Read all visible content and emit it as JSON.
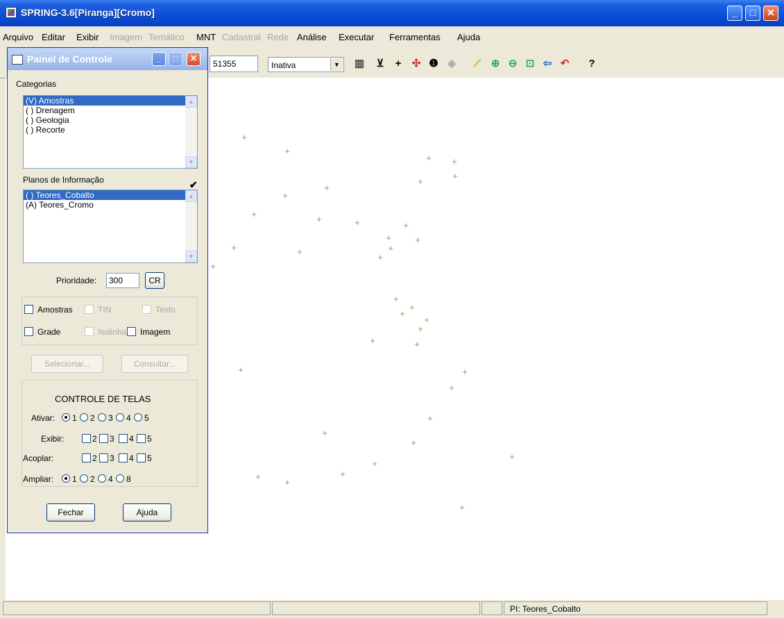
{
  "window": {
    "title": "SPRING-3.6[Piranga][Cromo]"
  },
  "menu": [
    {
      "label": "Arquivo",
      "enabled": true
    },
    {
      "label": "Editar",
      "enabled": true
    },
    {
      "label": "Exibir",
      "enabled": true
    },
    {
      "label": "Imagem",
      "enabled": false
    },
    {
      "label": "Temático",
      "enabled": false
    },
    {
      "label": "MNT",
      "enabled": true
    },
    {
      "label": "Cadastral",
      "enabled": false
    },
    {
      "label": "Rede",
      "enabled": false
    },
    {
      "label": "Análise",
      "enabled": true
    },
    {
      "label": "Executar",
      "enabled": true
    },
    {
      "label": "Ferramentas",
      "enabled": true
    },
    {
      "label": "Ajuda",
      "enabled": true
    }
  ],
  "toolbar": {
    "coord_value": "51355",
    "mode_selected": "Inativa",
    "icons": [
      "histogram-icon",
      "cursor-area-icon",
      "plus-icon",
      "pan-icon",
      "info-icon",
      "disabled-tool-icon",
      "pencil-icon",
      "zoom-in-icon",
      "zoom-out-icon",
      "zoom-area-icon",
      "back-arrow-icon",
      "undo-icon",
      "help-icon"
    ]
  },
  "panel": {
    "title": "Painel de Controle",
    "categorias_label": "Categorias",
    "categorias": [
      "(V) Amostras",
      "( ) Drenagem",
      "( ) Geologia",
      "( ) Recorte"
    ],
    "planos_label": "Planos de Informação",
    "planos": [
      "( ) Teores_Cobalto",
      "(A) Teores_Cromo"
    ],
    "prioridade_label": "Prioridade:",
    "prioridade_value": "300",
    "cr_label": "CR",
    "checks": {
      "amostras": "Amostras",
      "tin": "TIN",
      "texto": "Texto",
      "grade": "Grade",
      "isolinhas": "Isolinhas",
      "imagem": "Imagem"
    },
    "selecionar_label": "Selecionar...",
    "consultar_label": "Consultar...",
    "controle_title": "CONTROLE DE TELAS",
    "ativar_label": "Ativar:",
    "exibir_label": "Exibir:",
    "acoplar_label": "Acoplar:",
    "ampliar_label": "Ampliar:",
    "telas": [
      "1",
      "2",
      "3",
      "4",
      "5"
    ],
    "telas_opt": [
      "2",
      "3",
      "4",
      "5"
    ],
    "ampliar_opts": [
      "1",
      "2",
      "4",
      "8"
    ],
    "fechar_label": "Fechar",
    "ajuda_label": "Ajuda"
  },
  "status": {
    "pi": "PI: Teores_Cobalto"
  },
  "sample_marker": "+",
  "samples": [
    [
      352,
      197
    ],
    [
      414,
      217
    ],
    [
      618,
      227
    ],
    [
      655,
      232
    ],
    [
      656,
      253
    ],
    [
      606,
      261
    ],
    [
      471,
      270
    ],
    [
      411,
      281
    ],
    [
      366,
      308
    ],
    [
      460,
      315
    ],
    [
      515,
      320
    ],
    [
      585,
      324
    ],
    [
      560,
      342
    ],
    [
      602,
      345
    ],
    [
      337,
      356
    ],
    [
      432,
      362
    ],
    [
      563,
      357
    ],
    [
      548,
      370
    ],
    [
      307,
      383
    ],
    [
      571,
      430
    ],
    [
      594,
      442
    ],
    [
      580,
      451
    ],
    [
      615,
      460
    ],
    [
      606,
      473
    ],
    [
      537,
      490
    ],
    [
      601,
      495
    ],
    [
      347,
      532
    ],
    [
      670,
      535
    ],
    [
      651,
      558
    ],
    [
      620,
      602
    ],
    [
      468,
      623
    ],
    [
      596,
      637
    ],
    [
      738,
      657
    ],
    [
      540,
      667
    ],
    [
      372,
      686
    ],
    [
      494,
      682
    ],
    [
      414,
      694
    ],
    [
      666,
      730
    ]
  ]
}
